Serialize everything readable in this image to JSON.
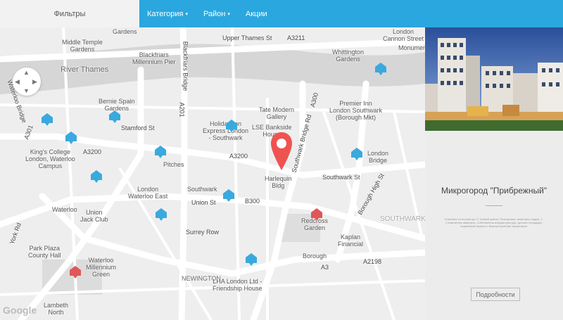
{
  "header": {
    "filters_label": "Фильтры",
    "nav": [
      {
        "label": "Категория",
        "has_caret": true
      },
      {
        "label": "Район",
        "has_caret": true
      },
      {
        "label": "Акции",
        "has_caret": false
      }
    ]
  },
  "map": {
    "labels": {
      "gardens_top": "Gardens",
      "middle_temple": "Middle Temple\nGardens",
      "blackfriars": "Blackfriars\nMillennium Pier",
      "upper_thames": "Upper Thames St",
      "a3211": "A3211",
      "cannon_street": "London\nCannon Street",
      "monument": "Monument",
      "river_thames": "River Thames",
      "whittington": "Whittington\nGardens",
      "waterloo_bridge": "Waterloo Bridge",
      "blackfriars_bridge": "Blackfriars Bridge",
      "bernie_spain": "Bernie Spain\nGardens",
      "tate_modern": "Tate Modern\nGallery",
      "premier_inn": "Premier Inn\nLondon Southwark\n(Borough Mkt)",
      "holiday_inn": "Holiday Inn\nExpress London\n- Southwark",
      "lse": "LSE Bankside\nHouse",
      "kings_college": "King's College\nLondon, Waterloo\nCampus",
      "stamford": "Stamford St",
      "a3200": "A3200",
      "pitches": "Pitches",
      "london_bridge": "London\nBridge",
      "harlequin": "Harlequin\nBldg",
      "southwark_st": "Southwark St",
      "southwark_bridge_rd": "Southwark Bridge Rd",
      "london_waterloo_east": "London\nWaterloo East",
      "southwark_stn": "Southwark",
      "union_st": "Union St",
      "b300": "B300",
      "waterloo": "Waterloo",
      "union_jack": "Union\nJack Club",
      "redcross": "Redcross\nGarden",
      "kaplan": "Kaplan\nFinancial",
      "borough_high": "Borough High St",
      "park_plaza": "Park Plaza\nCounty Hall",
      "waterloo_millennium": "Waterloo\nMillennium\nGreen",
      "surrey_row": "Surrey Row",
      "borough": "Borough",
      "a2198": "A2198",
      "newington": "NEWINGTON",
      "lha": "LHA London Ltd -\nFriendship House",
      "lambeth_north": "Lambeth\nNorth",
      "a3": "A3",
      "a201": "A201",
      "a300": "A300",
      "a301": "A301",
      "southwark_district": "SOUTHWARK",
      "york_rd": "York Rd",
      "google": "Google"
    }
  },
  "panel": {
    "title": "Микрогород \"Прибрежный\"",
    "description": "Комплекс из восьми до 17 этажей домов. Планировки: квартиры-студии, 1-3 комнатные квартиры. Собственная инфраструктура, детские площадки, подземный паркинг и благоустроенная территория.",
    "details_button": "Подробности"
  },
  "colors": {
    "topbar": "#2aa7df",
    "pin_blue": "#3aa9de",
    "pin_red": "#e05757",
    "accent_line": "#6fc3e7"
  }
}
